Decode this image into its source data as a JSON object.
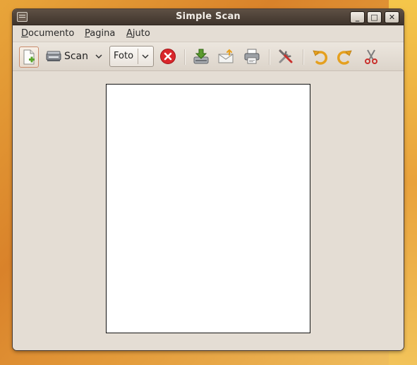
{
  "window": {
    "title": "Simple Scan",
    "controls": {
      "minimize": "_",
      "maximize": "□",
      "close": "✕"
    }
  },
  "menubar": {
    "items": [
      "Documento",
      "Pagina",
      "Ajuto"
    ]
  },
  "toolbar": {
    "scan_label": "Scan",
    "mode_value": "Foto",
    "icons": [
      "new-document-icon",
      "scanner-icon",
      "chevron-down-icon",
      "stop-icon",
      "save-icon",
      "email-icon",
      "print-icon",
      "preferences-icon",
      "rotate-left-icon",
      "rotate-right-icon",
      "crop-icon"
    ]
  },
  "colors": {
    "titlebar": "#4a3e35",
    "window_bg": "#e4ddd4",
    "page_bg": "#ffffff",
    "stop_red": "#d9262b",
    "rotate_orange": "#e5a01f",
    "save_green": "#5a9a2d"
  }
}
